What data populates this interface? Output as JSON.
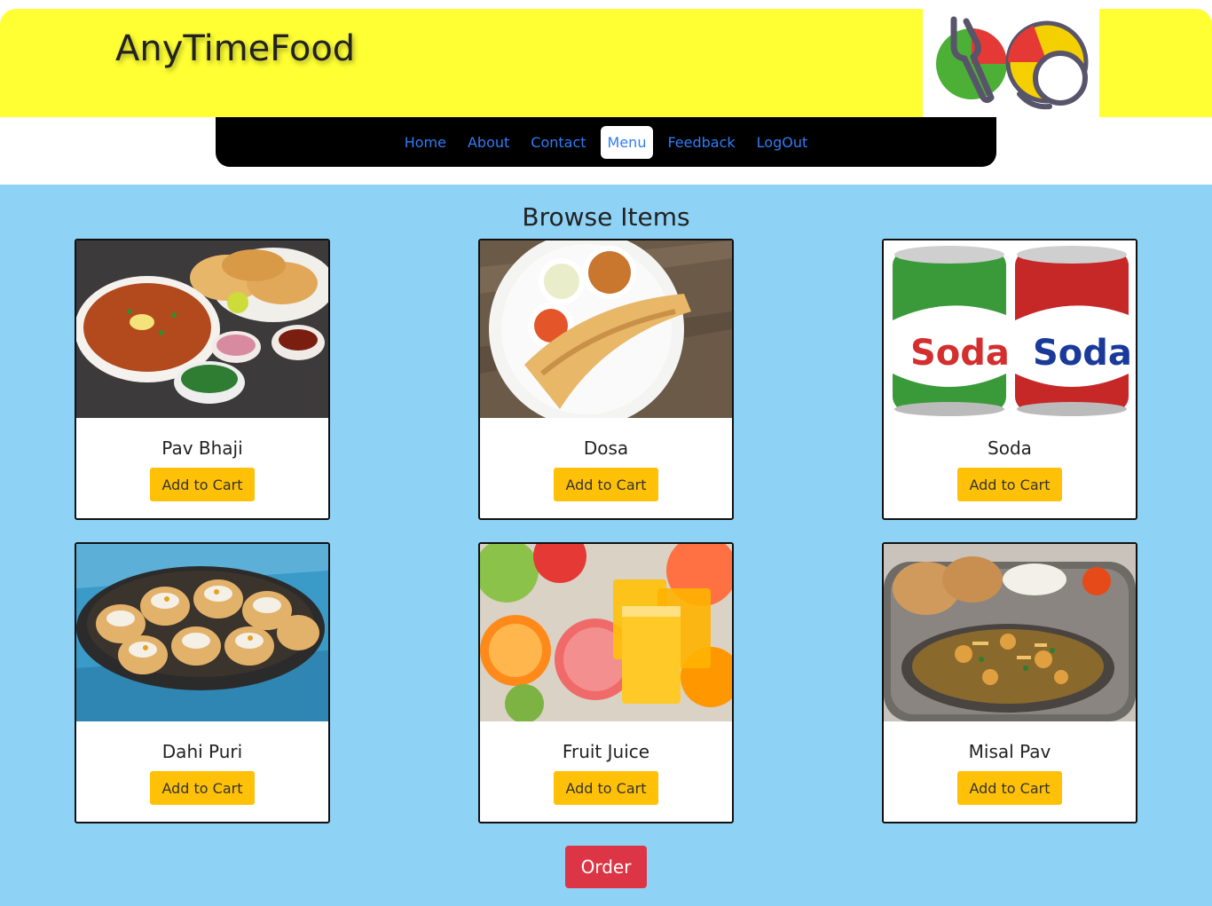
{
  "header": {
    "brand": "AnyTimeFood",
    "logo_icon": "fork-plate-icon",
    "colors": {
      "header_bg": "#ffff33",
      "nav_bg": "#000000",
      "main_bg": "#8ed3f6",
      "link": "#2f7cf6"
    }
  },
  "nav": {
    "items": [
      {
        "label": "Home"
      },
      {
        "label": "About"
      },
      {
        "label": "Contact"
      },
      {
        "label": "Menu",
        "active": true
      },
      {
        "label": "Feedback"
      },
      {
        "label": "LogOut"
      }
    ]
  },
  "main": {
    "title": "Browse Items",
    "items": [
      {
        "name": "Pav Bhaji",
        "button": "Add to Cart",
        "image": "pav-bhaji-image"
      },
      {
        "name": "Dosa",
        "button": "Add to Cart",
        "image": "dosa-image"
      },
      {
        "name": "Soda",
        "button": "Add to Cart",
        "image": "soda-image"
      },
      {
        "name": "Dahi Puri",
        "button": "Add to Cart",
        "image": "dahi-puri-image"
      },
      {
        "name": "Fruit Juice",
        "button": "Add to Cart",
        "image": "fruit-juice-image"
      },
      {
        "name": "Misal Pav",
        "button": "Add to Cart",
        "image": "misal-pav-image"
      }
    ],
    "order_label": "Order",
    "colors": {
      "cart_button": "#ffc107",
      "order_button": "#dc3545"
    }
  }
}
